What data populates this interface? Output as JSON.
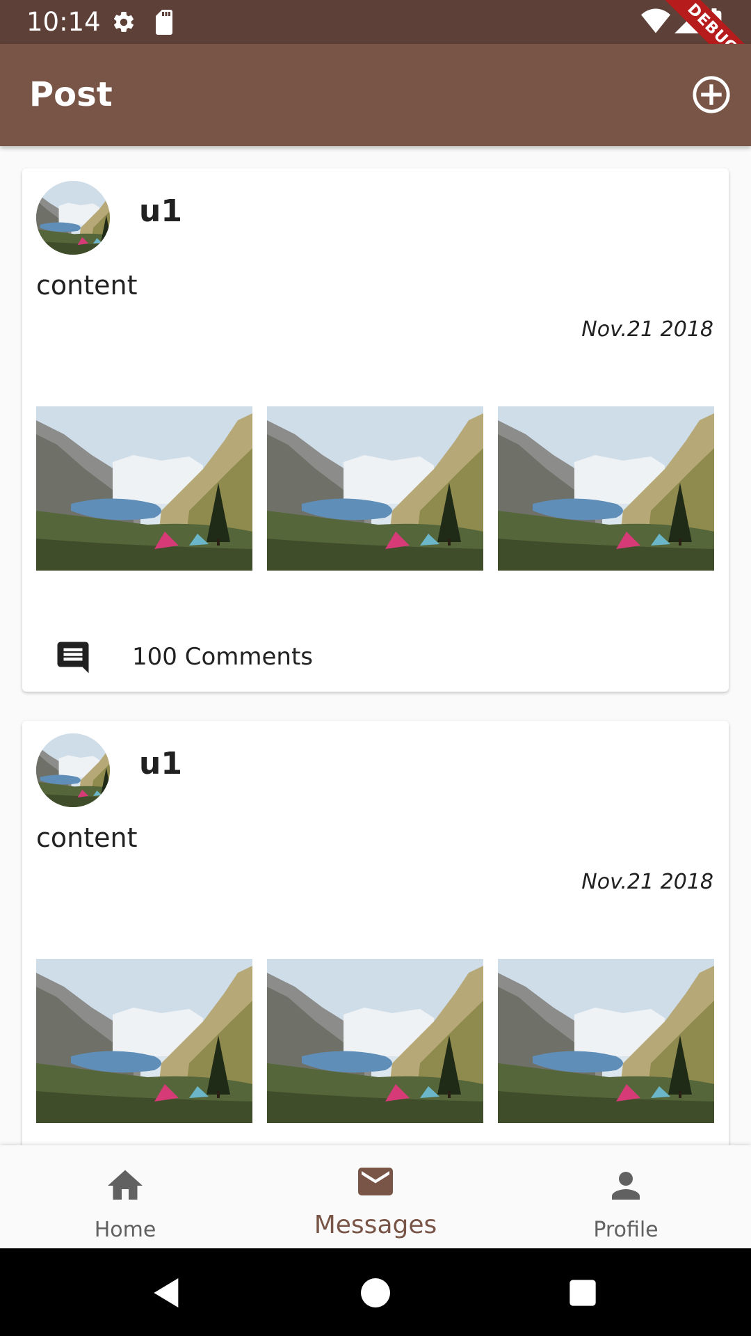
{
  "status_bar": {
    "time": "10:14",
    "debug_label": "DEBUG",
    "icons": [
      "settings-icon",
      "sd-card-icon",
      "wifi-icon",
      "signal-icon",
      "battery-icon"
    ]
  },
  "app_bar": {
    "title": "Post",
    "add_icon": "add-circle-outline-icon"
  },
  "posts": [
    {
      "username": "u1",
      "content": "content",
      "date": "Nov.21 2018",
      "image_count": 3,
      "comments_label": "100 Comments"
    },
    {
      "username": "u1",
      "content": "content",
      "date": "Nov.21 2018",
      "image_count": 3,
      "comments_label": ""
    }
  ],
  "bottom_nav": {
    "items": [
      {
        "label": "Home",
        "icon": "home-icon",
        "active": false
      },
      {
        "label": "Messages",
        "icon": "mail-icon",
        "active": true
      },
      {
        "label": "Profile",
        "icon": "person-icon",
        "active": false
      }
    ]
  },
  "colors": {
    "primary": "#795548",
    "primary_dark": "#5d4037",
    "debug_banner": "#b71c1c",
    "nav_inactive": "#616161"
  }
}
